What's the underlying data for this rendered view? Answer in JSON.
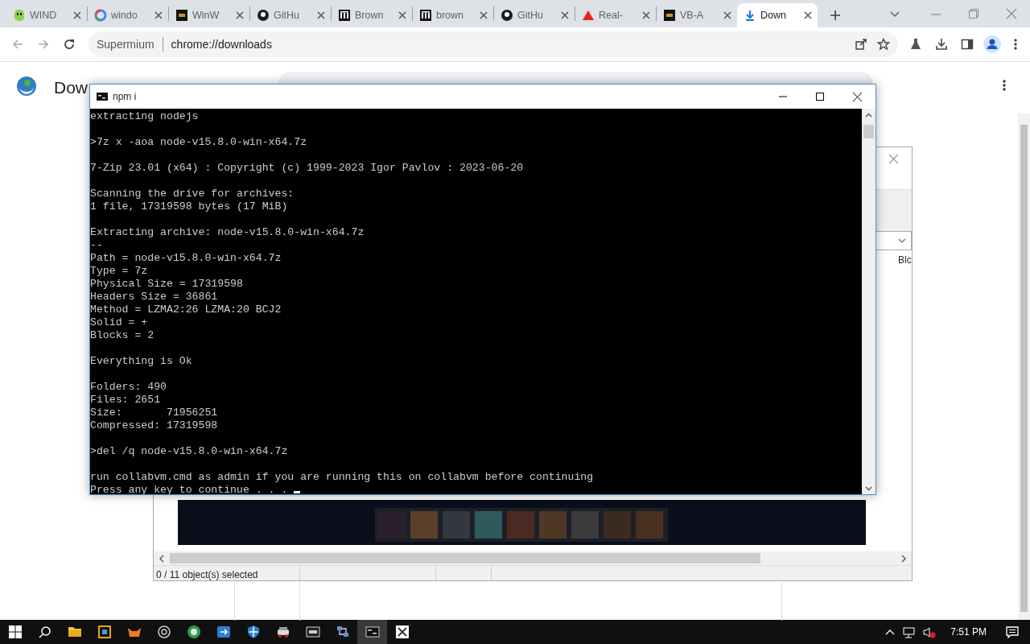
{
  "browser": {
    "tabs": [
      {
        "title": "WIND",
        "kind": "ghost",
        "selected": false
      },
      {
        "title": "windo",
        "kind": "ring",
        "selected": false
      },
      {
        "title": "WinW",
        "kind": "square",
        "selected": false
      },
      {
        "title": "GitHu",
        "kind": "circle",
        "selected": false
      },
      {
        "title": "Brown",
        "kind": "columns",
        "selected": false
      },
      {
        "title": "brown",
        "kind": "columns",
        "selected": false
      },
      {
        "title": "GitHu",
        "kind": "circle",
        "selected": false
      },
      {
        "title": "Real-",
        "kind": "triangle",
        "selected": false
      },
      {
        "title": "VB-A",
        "kind": "square",
        "selected": false
      },
      {
        "title": "Down",
        "kind": "download",
        "selected": true
      }
    ],
    "address": {
      "site_label": "Supermium",
      "url": "chrome://downloads"
    }
  },
  "page": {
    "title": "Dow"
  },
  "console_window": {
    "title": "npm i",
    "cursor": true,
    "blocks": [
      [
        "extracting nodejs"
      ],
      [
        ">7z x -aoa node-v15.8.0-win-x64.7z"
      ],
      [
        "7-Zip 23.01 (x64) : Copyright (c) 1999-2023 Igor Pavlov : 2023-06-20"
      ],
      [
        "Scanning the drive for archives:",
        "1 file, 17319598 bytes (17 MiB)"
      ],
      [
        "Extracting archive: node-v15.8.0-win-x64.7z",
        "--",
        "Path = node-v15.8.0-win-x64.7z",
        "Type = 7z",
        "Physical Size = 17319598",
        "Headers Size = 36861",
        "Method = LZMA2:26 LZMA:20 BCJ2",
        "Solid = +",
        "Blocks = 2"
      ],
      [
        "Everything is Ok"
      ],
      [
        "Folders: 490",
        "Files: 2651",
        "Size:       71956251",
        "Compressed: 17319598"
      ],
      [
        ">del /q node-v15.8.0-win-x64.7z"
      ],
      [
        "run collabvm.cmd as admin if you are running this on collabvm before continuing",
        "Press any key to continue . . ."
      ]
    ]
  },
  "explorer_window": {
    "column_header": "Blc",
    "status": "0 / 11 object(s) selected"
  },
  "taskbar": {
    "apps": [
      {
        "kind": "folder",
        "selected": false
      },
      {
        "kind": "tiles",
        "selected": false
      },
      {
        "kind": "fox",
        "selected": false
      },
      {
        "kind": "aperture",
        "selected": false
      },
      {
        "kind": "globe",
        "selected": false
      },
      {
        "kind": "arrow",
        "selected": false
      },
      {
        "kind": "shield",
        "selected": false
      },
      {
        "kind": "car",
        "selected": false
      },
      {
        "kind": "archive",
        "selected": false
      },
      {
        "kind": "network",
        "selected": false
      },
      {
        "kind": "console",
        "selected": true
      },
      {
        "kind": "scissors",
        "selected": false
      }
    ],
    "clock": "7:51 PM"
  }
}
